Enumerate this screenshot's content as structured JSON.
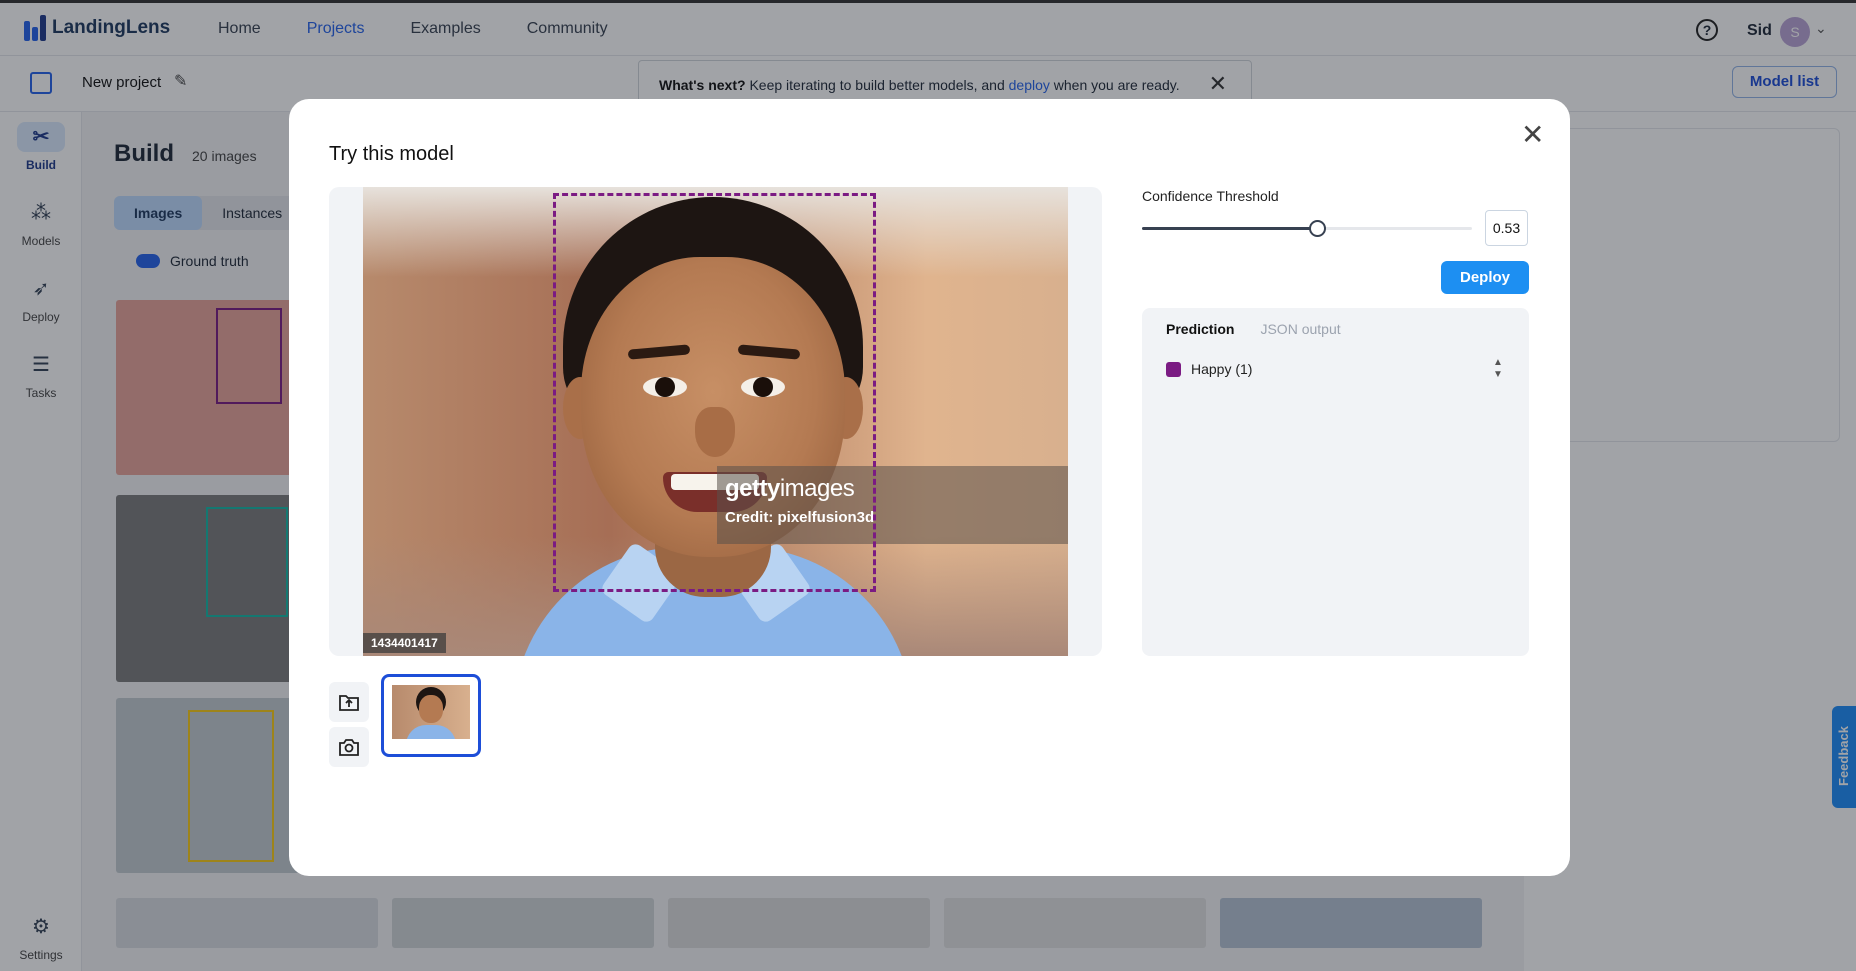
{
  "app": {
    "brand": "LandingLens",
    "nav": [
      "Home",
      "Projects",
      "Examples",
      "Community"
    ],
    "user": {
      "name": "Sid",
      "initial": "S"
    }
  },
  "project": {
    "name": "New project",
    "banner": {
      "lead": "What's next?",
      "text": " Keep iterating to build better models, and ",
      "link": "deploy",
      "tail": " when you are ready."
    },
    "model_list_label": "Model list"
  },
  "rail": [
    {
      "label": "Build"
    },
    {
      "label": "Models"
    },
    {
      "label": "Deploy"
    },
    {
      "label": "Tasks"
    },
    {
      "label": "Settings"
    }
  ],
  "build": {
    "title": "Build",
    "count": "20 images",
    "tabs": [
      "Images",
      "Instances"
    ],
    "ground_truth_label": "Ground truth"
  },
  "feedback_label": "Feedback",
  "modal": {
    "title": "Try this model",
    "image": {
      "watermark_logo_a": "getty",
      "watermark_logo_b": "images",
      "watermark_credit": "Credit: pixelfusion3d",
      "image_id": "1434401417"
    },
    "threshold": {
      "label": "Confidence Threshold",
      "value": "0.53",
      "fraction": 0.53
    },
    "deploy_label": "Deploy",
    "tabs": {
      "active": "Prediction",
      "inactive": "JSON output"
    },
    "predictions": [
      {
        "label": "Happy (1)",
        "color": "#7b1b83"
      }
    ]
  },
  "colors": {
    "accent": "#2563eb",
    "happy": "#7b1b83",
    "angry": "#14b8a6",
    "sad": "#facc15"
  }
}
